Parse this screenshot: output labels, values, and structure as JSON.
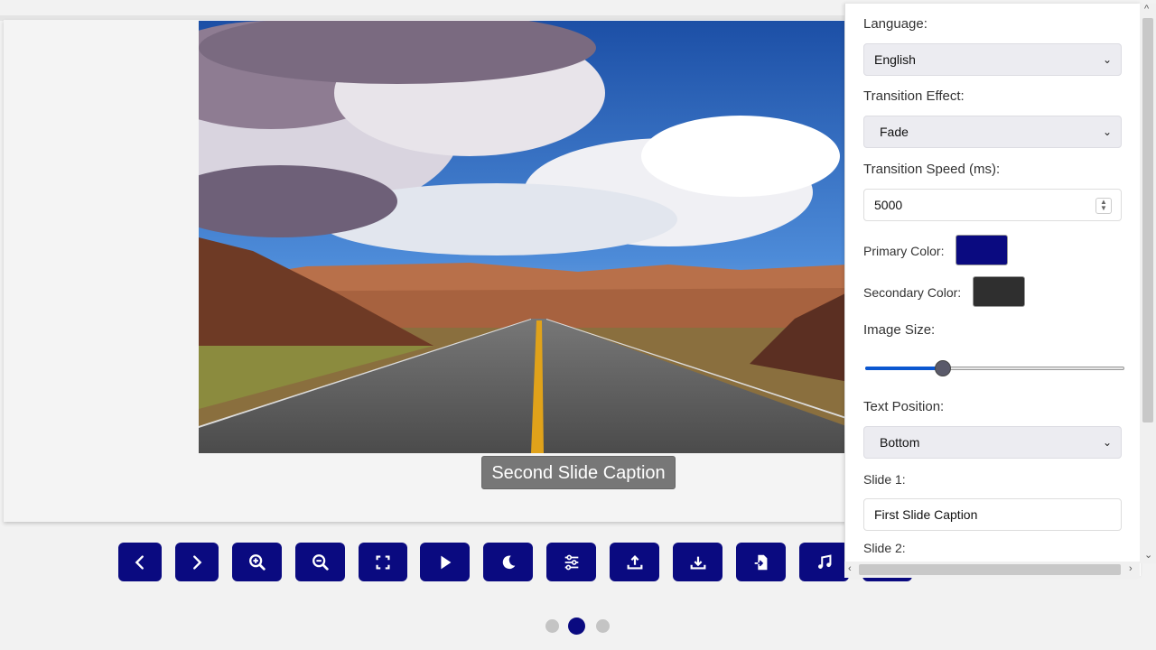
{
  "slideshow": {
    "caption": "Second Slide Caption",
    "current_slide": 2,
    "total_slides": 3
  },
  "controls": [
    {
      "name": "prev-button",
      "icon": "chevron-left-icon"
    },
    {
      "name": "next-button",
      "icon": "chevron-right-icon"
    },
    {
      "name": "zoom-in-button",
      "icon": "zoom-in-icon"
    },
    {
      "name": "zoom-out-button",
      "icon": "zoom-out-icon"
    },
    {
      "name": "fullscreen-button",
      "icon": "fullscreen-icon"
    },
    {
      "name": "play-button",
      "icon": "play-icon"
    },
    {
      "name": "dark-mode-button",
      "icon": "moon-icon"
    },
    {
      "name": "settings-button",
      "icon": "sliders-icon"
    },
    {
      "name": "upload-button",
      "icon": "upload-icon"
    },
    {
      "name": "download-button",
      "icon": "download-icon"
    },
    {
      "name": "import-button",
      "icon": "file-import-icon"
    },
    {
      "name": "music-button",
      "icon": "music-icon"
    }
  ],
  "settings": {
    "language_label": "Language:",
    "language_value": "English",
    "transition_effect_label": "Transition Effect:",
    "transition_effect_value": "Fade",
    "transition_speed_label": "Transition Speed (ms):",
    "transition_speed_value": "5000",
    "primary_color_label": "Primary Color:",
    "primary_color": "#0a0a80",
    "secondary_color_label": "Secondary Color:",
    "secondary_color": "#2f2f2f",
    "image_size_label": "Image Size:",
    "image_size_fraction": 0.3,
    "text_position_label": "Text Position:",
    "text_position_value": "Bottom",
    "slide1_label": "Slide 1:",
    "slide1_caption": "First Slide Caption",
    "slide2_label": "Slide 2:"
  },
  "colors": {
    "accent": "#0a0a80",
    "dot_active": "#0a0a80",
    "dot_inactive": "#c4c4c4"
  }
}
